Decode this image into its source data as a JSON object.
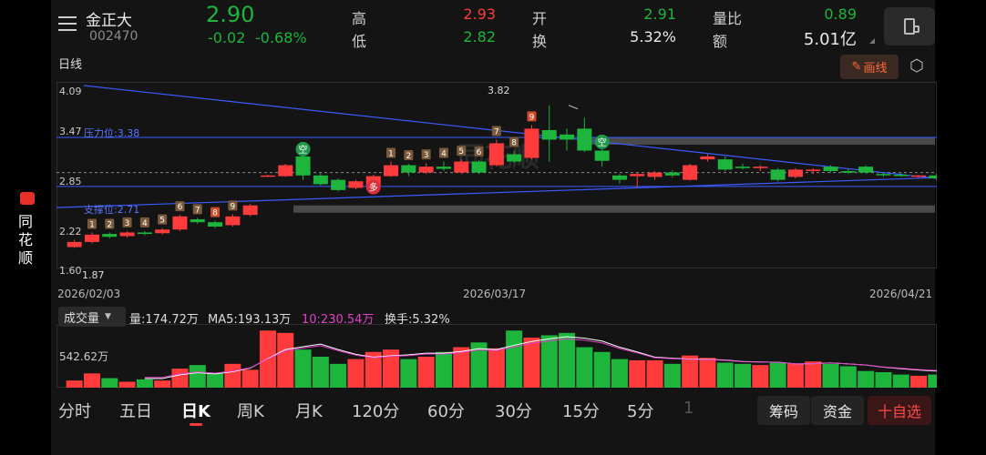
{
  "side": {
    "brand_chars": [
      "同",
      "花",
      "顺"
    ]
  },
  "header": {
    "stock_name": "金正大",
    "stock_code": "002470",
    "price": "2.90",
    "change": "-0.02",
    "change_pct": "-0.68%",
    "stats": [
      {
        "label": "高",
        "value": "2.93",
        "color": "red"
      },
      {
        "label": "低",
        "value": "2.82",
        "color": "green"
      },
      {
        "label": "开",
        "value": "2.91",
        "color": "green"
      },
      {
        "label": "换",
        "value": "5.32%",
        "color": "white"
      },
      {
        "label": "量比",
        "value": "0.89",
        "color": "green"
      },
      {
        "label": "额",
        "value": "5.01亿",
        "color": "white"
      }
    ]
  },
  "chart_header": {
    "period": "日线",
    "draw_button": "画线"
  },
  "price_panel": {
    "y_labels": [
      "4.09",
      "3.47",
      "2.85",
      "2.22",
      "1.60"
    ],
    "pressure_label": "压力位:3.38",
    "support_label": "支撑位:2.71",
    "high_mark": "3.82",
    "low_mark": "1.87",
    "dates": [
      "2026/02/03",
      "2026/03/17",
      "2026/04/21"
    ],
    "signal_kong": "空",
    "signal_duo": "多",
    "watermark": "同花顺",
    "seq_numbers": [
      "1",
      "2",
      "3",
      "4",
      "5",
      "6",
      "7",
      "8",
      "9",
      "1",
      "2",
      "3",
      "4",
      "5",
      "6",
      "7",
      "8",
      "9"
    ]
  },
  "volume_panel": {
    "indicator": "成交量",
    "vol": "量:174.72万",
    "ma5": "MA5:193.13万",
    "ma10": "10:230.54万",
    "turnover": "换手:5.32%",
    "y_label": "542.62万"
  },
  "bottom_tabs": [
    "分时",
    "五日",
    "日K",
    "周K",
    "月K",
    "120分",
    "60分",
    "30分",
    "15分",
    "5分",
    "1"
  ],
  "active_tab": "日K",
  "bottom_buttons": {
    "chips": "筹码",
    "funds": "资金",
    "watchlist": "十自选"
  },
  "colors": {
    "up": "#ff3b3b",
    "down": "#1db53c",
    "line": "#3b5bff",
    "accent": "#ff6a3a"
  },
  "chart_data": {
    "type": "candlestick",
    "candles": [
      {
        "o": 1.88,
        "c": 1.95,
        "h": 1.98,
        "l": 1.87
      },
      {
        "o": 1.95,
        "c": 2.05,
        "h": 2.08,
        "l": 1.93
      },
      {
        "o": 2.06,
        "c": 2.02,
        "h": 2.08,
        "l": 2.0
      },
      {
        "o": 2.03,
        "c": 2.08,
        "h": 2.1,
        "l": 2.01
      },
      {
        "o": 2.08,
        "c": 2.06,
        "h": 2.1,
        "l": 2.04
      },
      {
        "o": 2.07,
        "c": 2.12,
        "h": 2.14,
        "l": 2.05
      },
      {
        "o": 2.12,
        "c": 2.3,
        "h": 2.32,
        "l": 2.1
      },
      {
        "o": 2.26,
        "c": 2.22,
        "h": 2.28,
        "l": 2.2
      },
      {
        "o": 2.22,
        "c": 2.16,
        "h": 2.24,
        "l": 2.14
      },
      {
        "o": 2.18,
        "c": 2.3,
        "h": 2.33,
        "l": 2.16
      },
      {
        "o": 2.32,
        "c": 2.45,
        "h": 2.47,
        "l": 2.3
      },
      {
        "o": 2.85,
        "c": 2.86,
        "h": 2.87,
        "l": 2.84
      },
      {
        "o": 2.85,
        "c": 3.0,
        "h": 3.02,
        "l": 2.84
      },
      {
        "o": 3.12,
        "c": 2.86,
        "h": 3.13,
        "l": 2.8
      },
      {
        "o": 2.86,
        "c": 2.74,
        "h": 2.9,
        "l": 2.72
      },
      {
        "o": 2.8,
        "c": 2.66,
        "h": 2.82,
        "l": 2.64
      },
      {
        "o": 2.69,
        "c": 2.78,
        "h": 2.8,
        "l": 2.67
      },
      {
        "o": 2.72,
        "c": 2.85,
        "h": 2.87,
        "l": 2.7
      },
      {
        "o": 2.85,
        "c": 3.0,
        "h": 3.05,
        "l": 2.84
      },
      {
        "o": 3.0,
        "c": 2.9,
        "h": 3.02,
        "l": 2.85
      },
      {
        "o": 2.9,
        "c": 2.98,
        "h": 3.03,
        "l": 2.88
      },
      {
        "o": 2.98,
        "c": 2.95,
        "h": 3.05,
        "l": 2.92
      },
      {
        "o": 2.9,
        "c": 3.05,
        "h": 3.08,
        "l": 2.88
      },
      {
        "o": 3.05,
        "c": 2.9,
        "h": 3.07,
        "l": 2.88
      },
      {
        "o": 3.0,
        "c": 3.3,
        "h": 3.35,
        "l": 2.98
      },
      {
        "o": 3.15,
        "c": 3.05,
        "h": 3.2,
        "l": 3.03
      },
      {
        "o": 3.1,
        "c": 3.5,
        "h": 3.55,
        "l": 3.08
      },
      {
        "o": 3.48,
        "c": 3.35,
        "h": 3.82,
        "l": 3.05
      },
      {
        "o": 3.42,
        "c": 3.35,
        "h": 3.5,
        "l": 3.2
      },
      {
        "o": 3.5,
        "c": 3.2,
        "h": 3.65,
        "l": 3.18
      },
      {
        "o": 3.2,
        "c": 3.06,
        "h": 3.25,
        "l": 2.98
      },
      {
        "o": 2.86,
        "c": 2.8,
        "h": 2.88,
        "l": 2.75
      },
      {
        "o": 2.85,
        "c": 2.88,
        "h": 2.9,
        "l": 2.7
      },
      {
        "o": 2.84,
        "c": 2.9,
        "h": 2.92,
        "l": 2.8
      },
      {
        "o": 2.9,
        "c": 2.86,
        "h": 2.93,
        "l": 2.83
      },
      {
        "o": 2.8,
        "c": 3.0,
        "h": 3.02,
        "l": 2.79
      },
      {
        "o": 3.08,
        "c": 3.12,
        "h": 3.15,
        "l": 3.05
      },
      {
        "o": 3.08,
        "c": 2.94,
        "h": 3.12,
        "l": 2.92
      },
      {
        "o": 2.98,
        "c": 2.96,
        "h": 3.02,
        "l": 2.94
      },
      {
        "o": 2.96,
        "c": 2.98,
        "h": 3.0,
        "l": 2.92
      },
      {
        "o": 2.94,
        "c": 2.8,
        "h": 2.96,
        "l": 2.78
      },
      {
        "o": 2.84,
        "c": 2.94,
        "h": 2.96,
        "l": 2.82
      },
      {
        "o": 2.92,
        "c": 2.94,
        "h": 2.96,
        "l": 2.88
      },
      {
        "o": 2.98,
        "c": 2.92,
        "h": 3.0,
        "l": 2.9
      },
      {
        "o": 2.92,
        "c": 2.9,
        "h": 2.95,
        "l": 2.88
      },
      {
        "o": 2.98,
        "c": 2.9,
        "h": 3.0,
        "l": 2.88
      },
      {
        "o": 2.88,
        "c": 2.87,
        "h": 2.9,
        "l": 2.84
      },
      {
        "o": 2.87,
        "c": 2.86,
        "h": 2.89,
        "l": 2.84
      },
      {
        "o": 2.85,
        "c": 2.86,
        "h": 2.87,
        "l": 2.82
      },
      {
        "o": 2.86,
        "c": 2.82,
        "h": 2.88,
        "l": 2.8
      },
      {
        "o": 2.82,
        "c": 2.93,
        "h": 2.94,
        "l": 2.78
      },
      {
        "o": 2.91,
        "c": 2.9,
        "h": 2.93,
        "l": 2.82
      }
    ],
    "volumes": [
      30,
      60,
      40,
      25,
      35,
      30,
      80,
      95,
      60,
      100,
      75,
      240,
      230,
      160,
      130,
      100,
      120,
      150,
      160,
      120,
      130,
      150,
      170,
      190,
      165,
      240,
      210,
      220,
      230,
      170,
      150,
      120,
      115,
      115,
      100,
      135,
      125,
      105,
      100,
      95,
      105,
      100,
      110,
      100,
      90,
      70,
      65,
      55,
      50,
      55,
      75,
      55
    ],
    "ma_line": [
      null,
      null,
      null,
      null,
      38,
      38,
      54,
      63,
      58,
      67,
      82,
      122,
      160,
      172,
      183,
      160,
      140,
      128,
      134,
      138,
      145,
      145,
      152,
      164,
      160,
      178,
      194,
      205,
      214,
      208,
      196,
      170,
      150,
      128,
      124,
      120,
      119,
      116,
      110,
      108,
      107,
      100,
      101,
      104,
      100,
      95,
      86,
      80,
      74,
      70,
      72,
      72
    ],
    "ylim_price": [
      1.6,
      4.09
    ],
    "ylim_volume": [
      0,
      260
    ],
    "pressure": 3.38,
    "support": 2.71,
    "line_top": [
      [
        0,
        4.09
      ],
      [
        51,
        2.82
      ]
    ],
    "line_bottom": [
      [
        0,
        2.42
      ],
      [
        51,
        2.83
      ]
    ]
  }
}
